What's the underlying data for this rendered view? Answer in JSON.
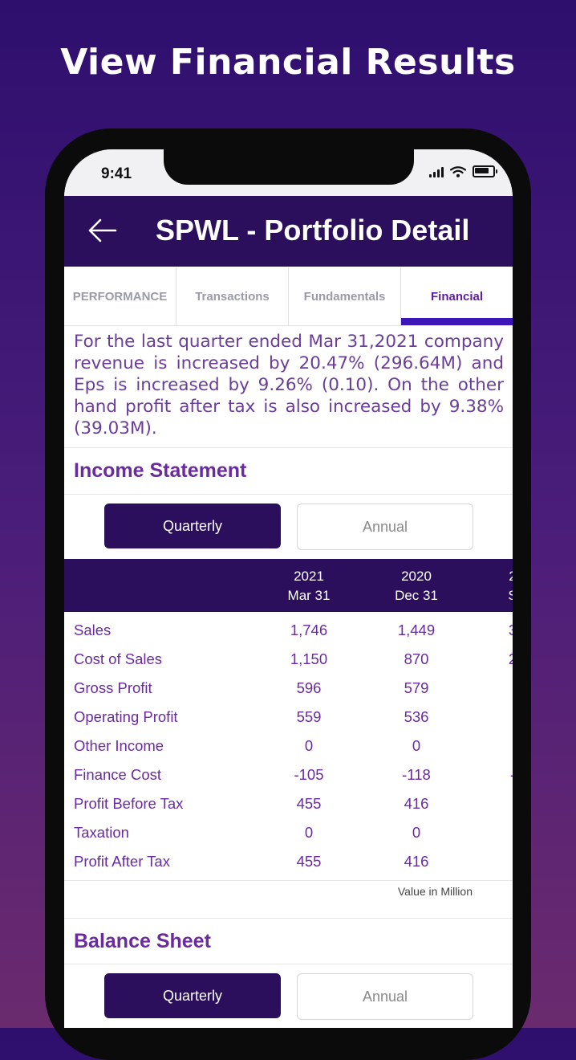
{
  "promo": {
    "title": "View Financial Results"
  },
  "status_bar": {
    "time": "9:41"
  },
  "header": {
    "title": "SPWL - Portfolio Detail"
  },
  "tabs": [
    {
      "label": "PERFORMANCE"
    },
    {
      "label": "Transactions"
    },
    {
      "label": "Fundamentals"
    },
    {
      "label": "Financial"
    }
  ],
  "summary": "For the last quarter ended Mar 31,2021 company revenue is increased by 20.47% (296.64M) and Eps is increased by 9.26% (0.10). On the other hand profit after tax is also increased by 9.38% (39.03M).",
  "income_statement": {
    "title": "Income Statement",
    "quarterly_label": "Quarterly",
    "annual_label": "Annual",
    "columns": [
      {
        "year": "2021",
        "date": "Mar 31"
      },
      {
        "year": "2020",
        "date": "Dec 31"
      },
      {
        "year": "2",
        "date": "S"
      }
    ],
    "rows": [
      {
        "label": "Sales",
        "values": [
          "1,746",
          "1,449",
          "3"
        ]
      },
      {
        "label": "Cost of Sales",
        "values": [
          "1,150",
          "870",
          "2"
        ]
      },
      {
        "label": "Gross Profit",
        "values": [
          "596",
          "579",
          ""
        ]
      },
      {
        "label": "Operating Profit",
        "values": [
          "559",
          "536",
          ""
        ]
      },
      {
        "label": "Other Income",
        "values": [
          "0",
          "0",
          ""
        ]
      },
      {
        "label": "Finance Cost",
        "values": [
          "-105",
          "-118",
          "-"
        ]
      },
      {
        "label": "Profit Before Tax",
        "values": [
          "455",
          "416",
          ""
        ]
      },
      {
        "label": "Taxation",
        "values": [
          "0",
          "0",
          ""
        ]
      },
      {
        "label": "Profit After Tax",
        "values": [
          "455",
          "416",
          ""
        ]
      }
    ],
    "note": "Value in Million"
  },
  "balance_sheet": {
    "title": "Balance Sheet",
    "quarterly_label": "Quarterly",
    "annual_label": "Annual"
  },
  "colors": {
    "primary": "#2b0f5c",
    "accent_text": "#6a2aa0",
    "tab_indicator": "#3d16b8"
  }
}
